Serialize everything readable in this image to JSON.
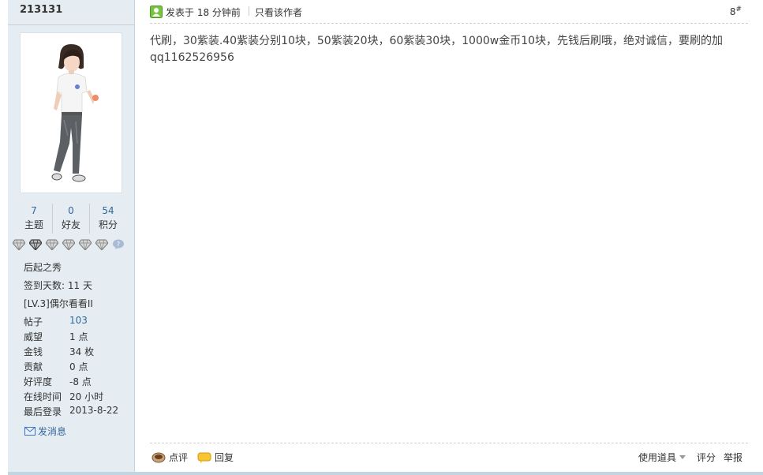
{
  "sidebar": {
    "username": "213131",
    "stats": [
      {
        "value": "7",
        "label": "主题"
      },
      {
        "value": "0",
        "label": "好友"
      },
      {
        "value": "54",
        "label": "积分"
      }
    ],
    "title": "后起之秀",
    "checkin": "签到天数: 11 天",
    "level": "[LV.3]偶尔看看II",
    "details": [
      {
        "key": "帖子",
        "value": "103"
      },
      {
        "key": "威望",
        "value": "1 点"
      },
      {
        "key": "金钱",
        "value": "34 枚"
      },
      {
        "key": "贡献",
        "value": "0 点"
      },
      {
        "key": "好评度",
        "value": "-8 点"
      },
      {
        "key": "在线时间",
        "value": "20 小时"
      },
      {
        "key": "最后登录",
        "value": "2013-8-22"
      }
    ],
    "send_message": "发消息"
  },
  "post": {
    "posted": "发表于 18 分钟前",
    "only_author": "只看该作者",
    "floor_number": "8",
    "floor_mark": "#",
    "content_line1": "代刷，30紫装.40紫装分别10块，50紫装20块，60紫装30块，1000w金币10块，先钱后刷哦，绝对诚信，要刷的加",
    "content_line2": "qq1162526956"
  },
  "footer": {
    "comment": "点评",
    "reply": "回复",
    "use_tool": "使用道具",
    "rate": "评分",
    "report": "举报"
  },
  "colors": {
    "sidebar_bg": "#e5edf2",
    "link": "#336699",
    "border": "#c2d5e3"
  }
}
